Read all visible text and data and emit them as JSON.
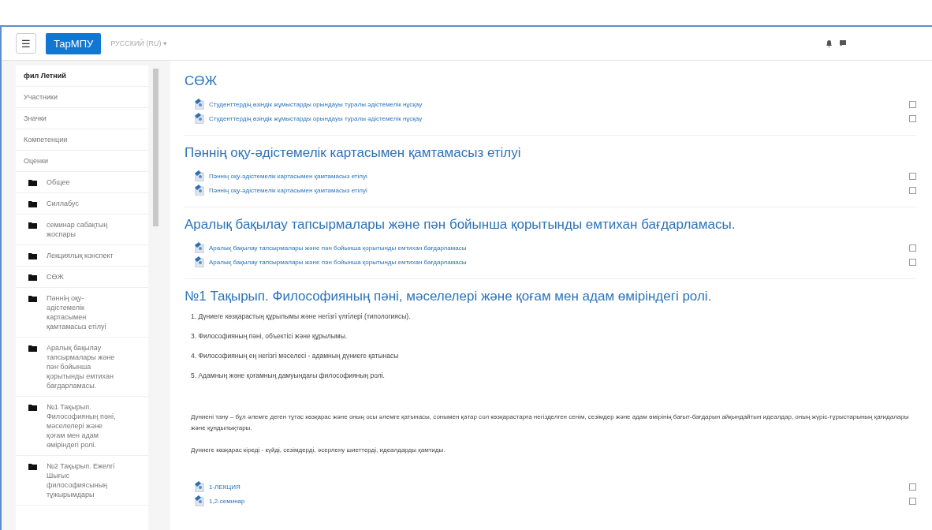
{
  "navbar": {
    "menu_icon": "☰",
    "brand": "ТарМПУ",
    "language": "РУССКИЙ (RU) ▾"
  },
  "sidebar": {
    "items": [
      {
        "label": "фил Летний",
        "kind": "link",
        "selected": true
      },
      {
        "label": "Участники",
        "kind": "link",
        "selected": false
      },
      {
        "label": "Значки",
        "kind": "link",
        "selected": false
      },
      {
        "label": "Компетенции",
        "kind": "link",
        "selected": false
      },
      {
        "label": "Оценки",
        "kind": "link",
        "selected": false
      },
      {
        "label": "Общее",
        "kind": "folder",
        "selected": false
      },
      {
        "label": "Силлабус",
        "kind": "folder",
        "selected": false
      },
      {
        "label": "семинар сабақтың жоспары",
        "kind": "folder",
        "selected": false
      },
      {
        "label": "Лекциялық конспект",
        "kind": "folder",
        "selected": false
      },
      {
        "label": "СӨЖ",
        "kind": "folder",
        "selected": false
      },
      {
        "label": "Пәннің оқу-әдістемелік картасымен қамтамасыз етілуі",
        "kind": "folder",
        "selected": false
      },
      {
        "label": "Аралық бақылау тапсырмалары және пән бойынша қорытынды емтихан бағдарламасы.",
        "kind": "folder",
        "selected": false
      },
      {
        "label": "№1 Тақырып. Философияның пәні, мәселелері және қоғам мен адам өміріндегі ролі.",
        "kind": "folder",
        "selected": false
      },
      {
        "label": "№2 Тақырып. Ежелгі Шығыс философиясының тұжырымдары",
        "kind": "folder",
        "selected": false
      }
    ]
  },
  "sections": [
    {
      "title": "СӨЖ",
      "resources": [
        {
          "label": "Студенттердің өзіндік жұмыстарды орындауы туралы әдістемелік нұсқау",
          "checked": false
        },
        {
          "label": "Студенттердің өзіндік жұмыстарды орындауы туралы әдістемелік нұсқау",
          "checked": false
        }
      ]
    },
    {
      "title": "Пәннің оқу-әдістемелік картасымен қамтамасыз етілуі",
      "resources": [
        {
          "label": "Пәннің оқу-әдістемелік картасымен қамтамасыз етілуі",
          "checked": false
        },
        {
          "label": "Пәннің оқу-әдістемелік картасымен қамтамасыз етілуі",
          "checked": false
        }
      ]
    },
    {
      "title": "Аралық бақылау тапсырмалары және пән бойынша қорытынды емтихан бағдарламасы.",
      "resources": [
        {
          "label": "Аралық бақылау тапсырмалары және пән бойынша қорытынды емтихан бағдарламасы",
          "checked": false
        },
        {
          "label": "Аралық бақылау тапсырмалары және пән бойынша қорытынды емтихан бағдарламасы",
          "checked": false
        }
      ]
    },
    {
      "title": "№1 Тақырып. Философияның пәні, мәселелері және қоғам мен адам өміріндегі ролі.",
      "lines": [
        "1. Дүниеге көзқарастың құрылымы және негізгі үлгілері (типологиясы).",
        "3. Философияның пәні, объектісі және құрылымы.",
        "4. Философияның ең негізгі мәселесі - адамның дүниеге қатынасы",
        "5. Адамның және қоғамның дамуындағы философияның ролі."
      ],
      "paragraphs": [
        "Дүниені тану – бұл әлемге деген тұтас көзқарас және оның осы әлемге қатынасы, сонымен қатар сол көзқарастарға негізделген сенім, сезімдер және адам өмірінің бағыт-бағдарын айқындайтын идеалдар, оның жүріс-тұрыстарының қағидалары және құндылықтары.",
        "Дүниеге көзқарас кіреді - күйді, сезімдерді, әсерлену шиеттерді, идеалдарды қамтиды."
      ],
      "resources": [
        {
          "label": "1-ЛЕКЦИЯ",
          "checked": false
        },
        {
          "label": "1,2-семинар",
          "checked": false
        }
      ]
    }
  ]
}
